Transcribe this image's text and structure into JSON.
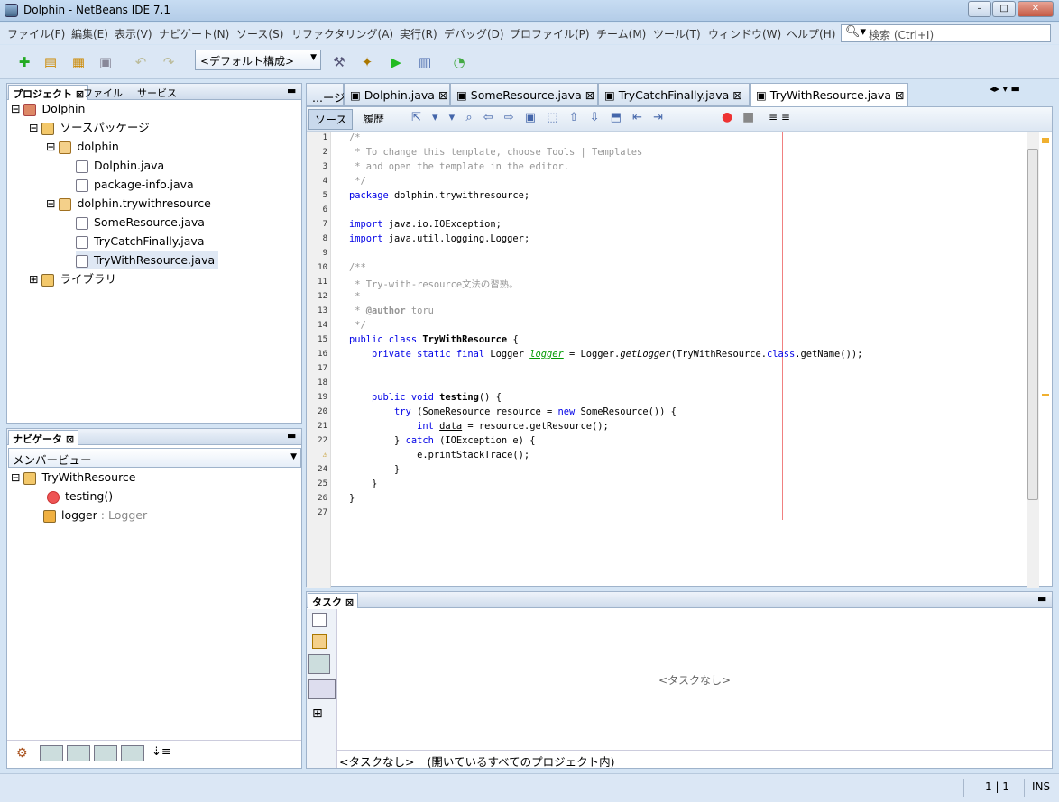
{
  "window": {
    "title": "Dolphin - NetBeans IDE 7.1",
    "min": "–",
    "max": "□",
    "close": "✕"
  },
  "menus": [
    "ファイル(F)",
    "編集(E)",
    "表示(V)",
    "ナビゲート(N)",
    "ソース(S)",
    "リファクタリング(A)",
    "実行(R)",
    "デバッグ(D)",
    "プロファイル(P)",
    "チーム(M)",
    "ツール(T)",
    "ウィンドウ(W)",
    "ヘルプ(H)"
  ],
  "search": {
    "placeholder": "検索 (Ctrl+I)",
    "icon": "search-icon"
  },
  "toolbar": {
    "config": "<デフォルト構成>"
  },
  "projects_panel": {
    "tabs": [
      "プロジェクト",
      "ファイル",
      "サービス"
    ],
    "tree": [
      {
        "label": "Dolphin"
      },
      {
        "label": "ソースパッケージ"
      },
      {
        "label": "dolphin"
      },
      {
        "label": "Dolphin.java"
      },
      {
        "label": "package-info.java"
      },
      {
        "label": "dolphin.trywithresource"
      },
      {
        "label": "SomeResource.java"
      },
      {
        "label": "TryCatchFinally.java"
      },
      {
        "label": "TryWithResource.java"
      },
      {
        "label": "ライブラリ"
      }
    ]
  },
  "navigator": {
    "tab": "ナビゲータ",
    "view": "メンバービュー",
    "items": [
      {
        "label": "TryWithResource"
      },
      {
        "label": "testing()"
      },
      {
        "label": "logger",
        "type": " : Logger"
      }
    ]
  },
  "editor": {
    "tabs": [
      "...ージ",
      "Dolphin.java",
      "SomeResource.java",
      "TryCatchFinally.java",
      "TryWithResource.java"
    ],
    "source_btn": "ソース",
    "history_btn": "履歴"
  },
  "tasks": {
    "tab": "タスク",
    "empty": "<タスクなし>",
    "footer_a": "<タスクなし>",
    "footer_b": "(開いているすべてのプロジェクト内)"
  },
  "status": {
    "position": "1 | 1",
    "mode": "INS"
  }
}
